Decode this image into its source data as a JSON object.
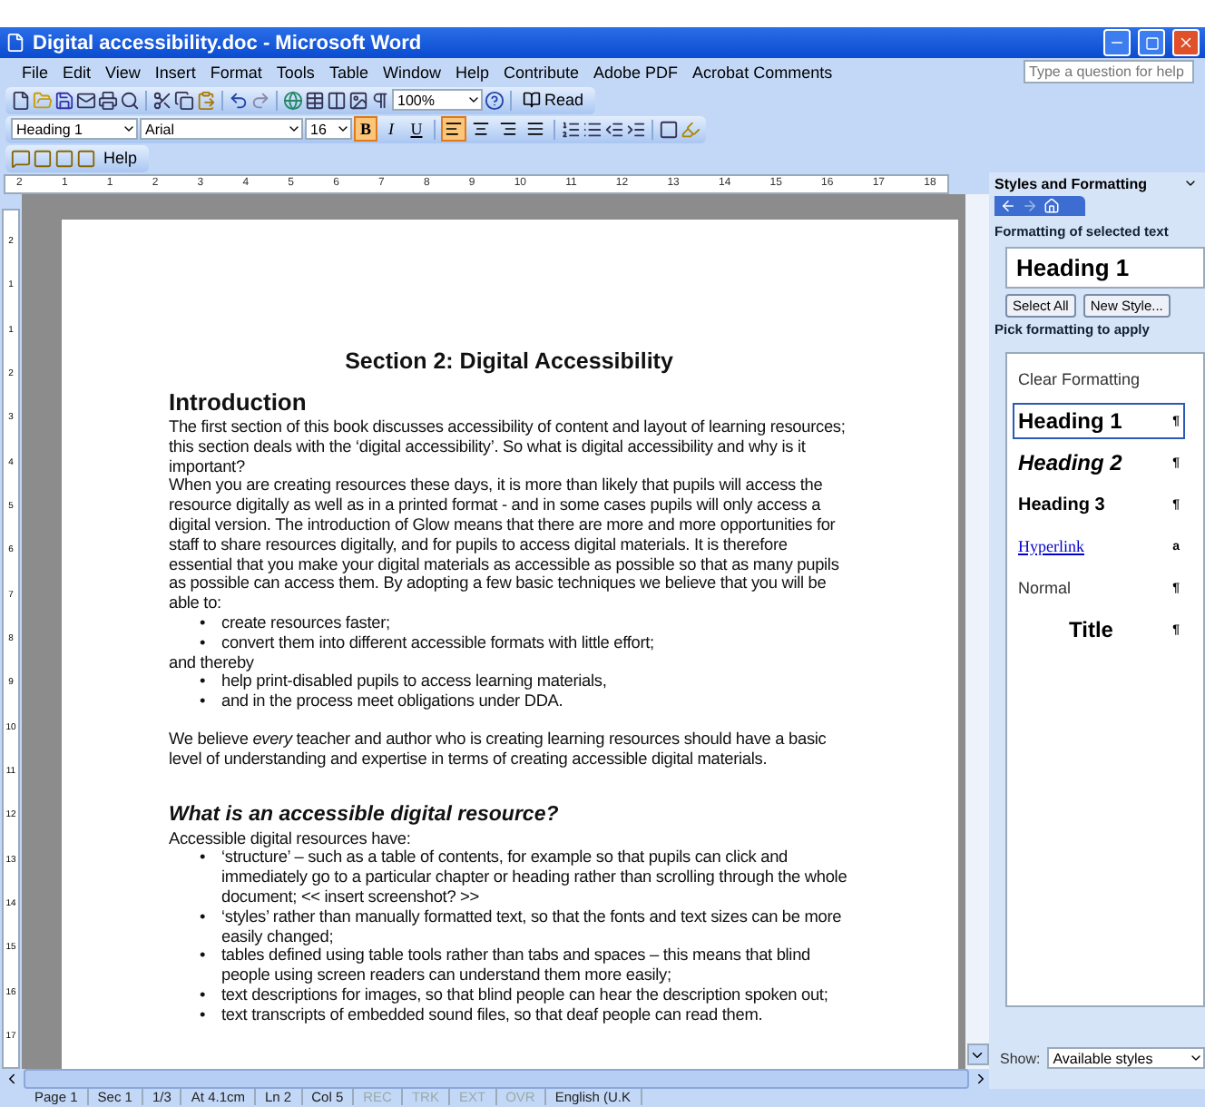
{
  "window": {
    "title": "Digital accessibility.doc - Microsoft Word"
  },
  "menu": [
    "File",
    "Edit",
    "View",
    "Insert",
    "Format",
    "Tools",
    "Table",
    "Window",
    "Help",
    "Contribute",
    "Adobe PDF",
    "Acrobat Comments"
  ],
  "help_search": {
    "placeholder": "Type a question for help"
  },
  "standard_toolbar": {
    "zoom": "100%",
    "read_button": "Read"
  },
  "formatting_toolbar": {
    "style": "Heading 1",
    "font": "Arial",
    "size": "16",
    "buttons": [
      {
        "kind": "bold",
        "label": "B",
        "selected": true
      },
      {
        "kind": "italic",
        "label": "I",
        "selected": false
      },
      {
        "kind": "underline",
        "label": "U",
        "selected": false
      }
    ],
    "alignments": [
      {
        "kind": "left",
        "selected": true
      },
      {
        "kind": "center",
        "selected": false
      },
      {
        "kind": "right",
        "selected": false
      },
      {
        "kind": "justify",
        "selected": false
      }
    ]
  },
  "extra_toolbar": {
    "help_button": "Help"
  },
  "ruler": [
    "2",
    "1",
    "1",
    "2",
    "3",
    "4",
    "5",
    "6",
    "7",
    "8",
    "9",
    "10",
    "11",
    "12",
    "13",
    "14",
    "15",
    "16",
    "17",
    "18"
  ],
  "vertical_ruler": [
    "2",
    "1",
    "1",
    "2",
    "3",
    "4",
    "5",
    "6",
    "7",
    "8",
    "9",
    "10",
    "11",
    "12",
    "13",
    "14",
    "15",
    "16",
    "17"
  ],
  "document": [
    {
      "kind": "title",
      "text": "Section 2: Digital Accessibility"
    },
    {
      "kind": "h1",
      "text": "Introduction"
    },
    {
      "kind": "p",
      "text": "The first section of this book discusses accessibility of content and layout of learning resources; this section deals with the ‘digital accessibility’. So what is digital accessibility and why is it important?"
    },
    {
      "kind": "p",
      "text": "When you are creating resources these days, it is more than likely that pupils will access the resource digitally as well as in a printed format - and in some cases pupils will only access a digital version. The introduction of Glow means that there are more and more opportunities for staff to share resources digitally, and for pupils to access digital materials. It is therefore essential that you make your digital materials as accessible as possible so that as many pupils as possible can access them. By adopting a few basic techniques we believe that you will be able to:"
    },
    {
      "kind": "list",
      "items": [
        {
          "bullet": "•",
          "text": "create resources faster;"
        },
        {
          "bullet": "•",
          "text": "convert them into different accessible formats with little effort;"
        }
      ]
    },
    {
      "kind": "p",
      "text": "and thereby"
    },
    {
      "kind": "list",
      "items": [
        {
          "bullet": "•",
          "text": "help print-disabled pupils to access learning materials,"
        },
        {
          "bullet": "•",
          "text": "and in the process meet obligations under DDA."
        }
      ]
    },
    {
      "kind": "spacer"
    },
    {
      "kind": "p",
      "text": "We believe *every* teacher and author who is creating learning resources should have a basic level of understanding and expertise in terms of creating accessible digital materials."
    },
    {
      "kind": "spacer"
    },
    {
      "kind": "h2",
      "text": "What is an accessible digital resource?"
    },
    {
      "kind": "p",
      "text": "Accessible digital resources have:"
    },
    {
      "kind": "list",
      "items": [
        {
          "bullet": "•",
          "text": "‘structure’ – such as a table of contents, for example so that pupils can click and immediately go to a particular chapter or heading rather than scrolling through the whole document; << insert screenshot? >>"
        },
        {
          "bullet": "•",
          "text": "‘styles’ rather than manually formatted text, so that the fonts and text sizes can be more easily changed;"
        },
        {
          "bullet": "•",
          "text": "tables defined using table tools rather than tabs and spaces – this means that blind people using screen readers can understand them more easily;"
        },
        {
          "bullet": "•",
          "text": " text descriptions for images, so that blind people can hear the description spoken out;"
        },
        {
          "bullet": "•",
          "text": "text transcripts of embedded sound files, so that deaf people can read them."
        }
      ]
    }
  ],
  "task_pane": {
    "title": "Styles and Formatting",
    "selected_heading": "Formatting of selected text",
    "selected_style": "Heading 1",
    "buttons": [
      "Select All",
      "New Style..."
    ],
    "pick_heading": "Pick formatting to apply",
    "styles": [
      {
        "kind": "clear",
        "label": "Clear Formatting",
        "selected": false
      },
      {
        "kind": "h1",
        "label": "Heading 1",
        "mark": "¶",
        "selected": true
      },
      {
        "kind": "h2",
        "label": "Heading 2",
        "mark": "¶",
        "selected": false
      },
      {
        "kind": "h3",
        "label": "Heading 3",
        "mark": "¶",
        "selected": false
      },
      {
        "kind": "link",
        "label": "Hyperlink",
        "mark": "a",
        "selected": false
      },
      {
        "kind": "normal",
        "label": "Normal",
        "mark": "¶",
        "selected": false
      },
      {
        "kind": "title",
        "label": "Title",
        "mark": "¶",
        "selected": false
      }
    ],
    "show_label": "Show:",
    "show_value": "Available styles"
  },
  "status_bar": [
    "Page 1",
    "Sec 1",
    "1/3",
    "At 4.1cm",
    "Ln 2",
    "Col 5",
    "REC",
    "TRK",
    "EXT",
    "OVR",
    "English (U.K"
  ]
}
